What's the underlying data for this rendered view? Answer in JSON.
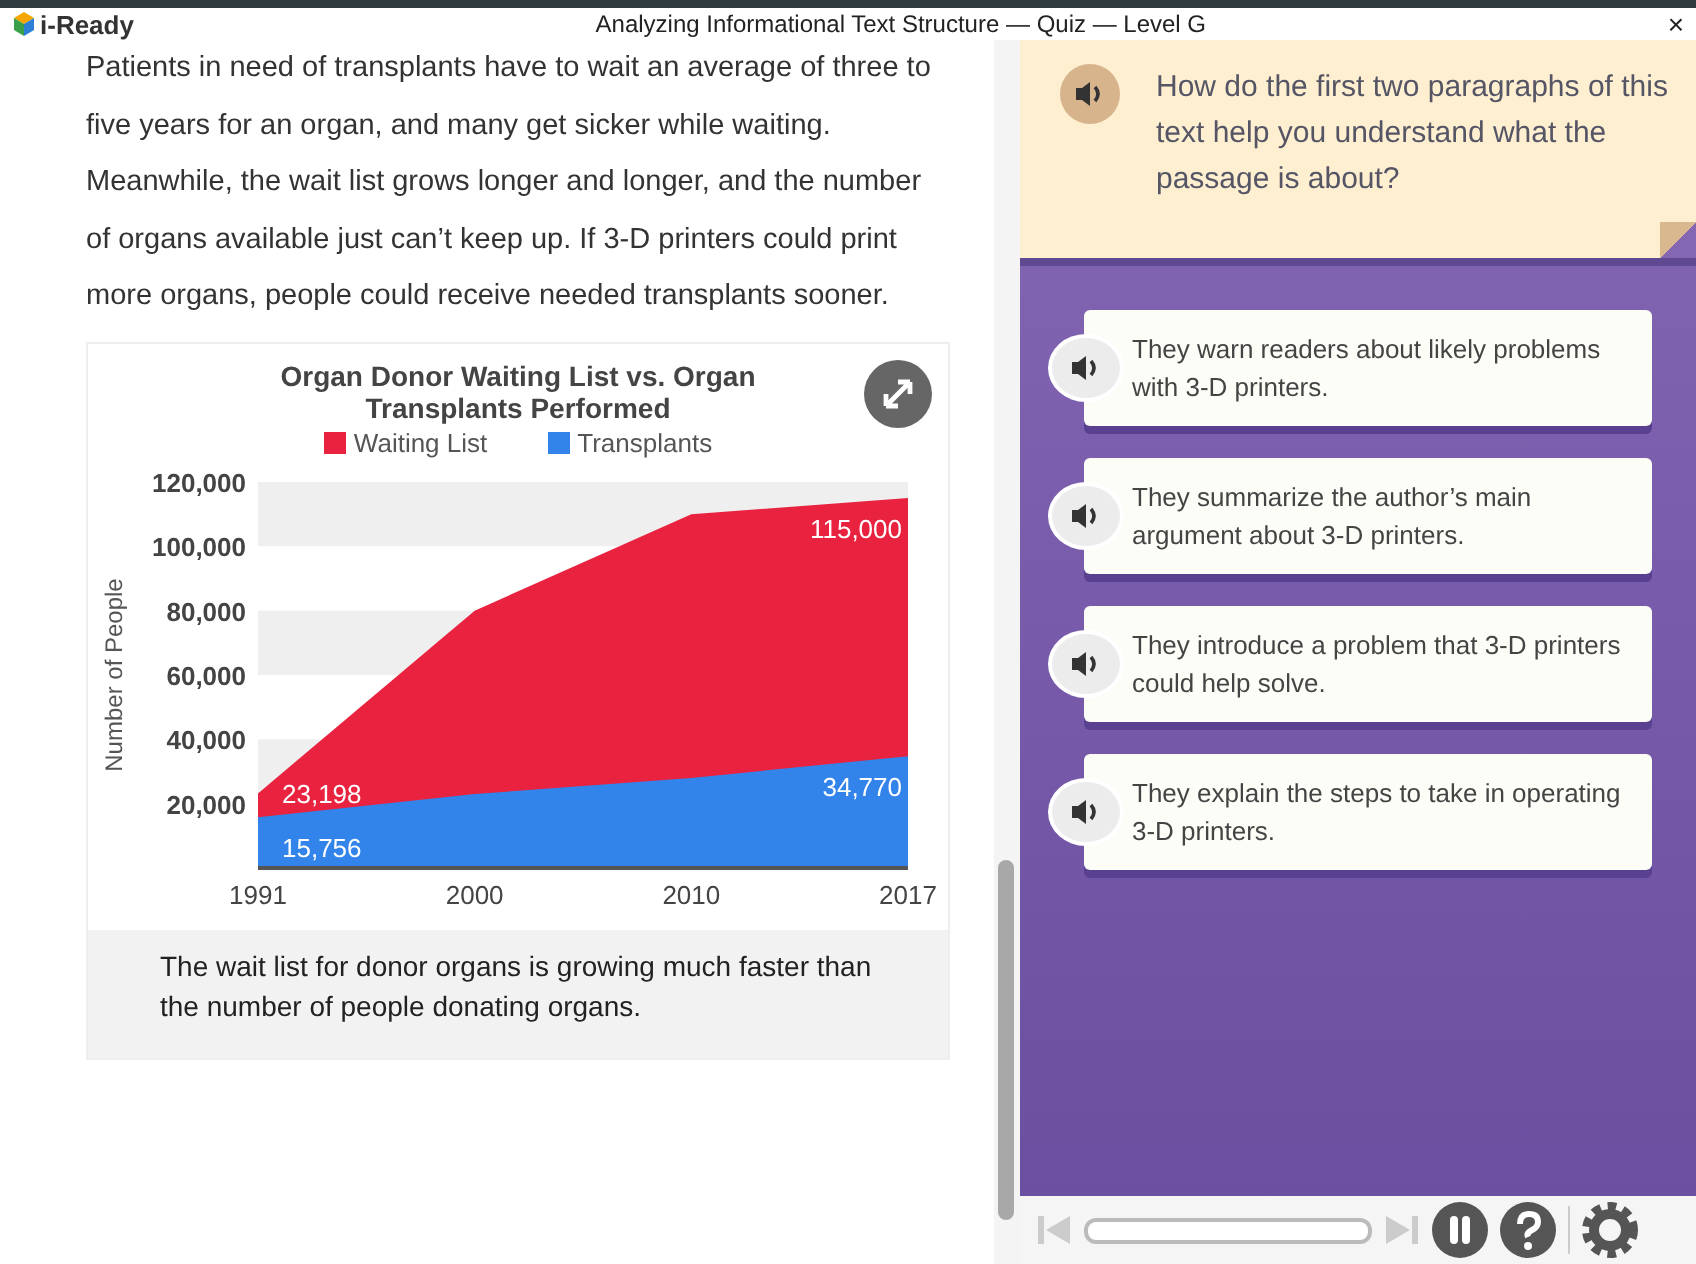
{
  "window": {
    "logo": "i-Ready",
    "title": "Analyzing Informational Text Structure — Quiz — Level G",
    "close": "×"
  },
  "passage": {
    "text": "Patients in need of transplants have to wait an average of three to five years for an organ, and many get sicker while waiting. Meanwhile, the wait list grows longer and longer, and the number of organs available just can’t keep up. If 3-D printers could print more organs, people could receive needed transplants sooner."
  },
  "figure": {
    "chart_data": {
      "type": "area",
      "title": "Organ Donor Waiting List vs. Organ Transplants Performed",
      "ylabel": "Number of People",
      "x": [
        "1991",
        "2000",
        "2010",
        "2017"
      ],
      "series": [
        {
          "name": "Waiting List",
          "color": "#e8223f",
          "values": [
            23198,
            80000,
            110000,
            115000
          ]
        },
        {
          "name": "Transplants",
          "color": "#3384ea",
          "values": [
            15756,
            23000,
            28000,
            34770
          ]
        }
      ],
      "ylim": [
        0,
        120000
      ],
      "yticks": [
        {
          "value": 20000,
          "label": "20,000"
        },
        {
          "value": 40000,
          "label": "40,000"
        },
        {
          "value": 60000,
          "label": "60,000"
        },
        {
          "value": 80000,
          "label": "80,000"
        },
        {
          "value": 100000,
          "label": "100,000"
        },
        {
          "value": 120000,
          "label": "120,000"
        }
      ],
      "annotations": [
        {
          "x": "1991",
          "y": 23198,
          "text": "23,198"
        },
        {
          "x": "2017",
          "y": 115000,
          "text": "115,000"
        },
        {
          "x": "1991",
          "y": 15756,
          "text": "15,756"
        },
        {
          "x": "2017",
          "y": 34770,
          "text": "34,770"
        }
      ]
    },
    "caption": "The wait list for donor organs is growing much faster than the number of people donating organs."
  },
  "question": {
    "text": "How do the first two paragraphs of this text help you understand what the passage is about?"
  },
  "answers": [
    {
      "text": "They warn readers about likely problems with 3-D printers."
    },
    {
      "text": "They summarize the author’s main argument about 3-D printers."
    },
    {
      "text": "They introduce a problem that 3-D printers could help solve."
    },
    {
      "text": "They explain the steps to take in operating 3-D printers."
    }
  ]
}
